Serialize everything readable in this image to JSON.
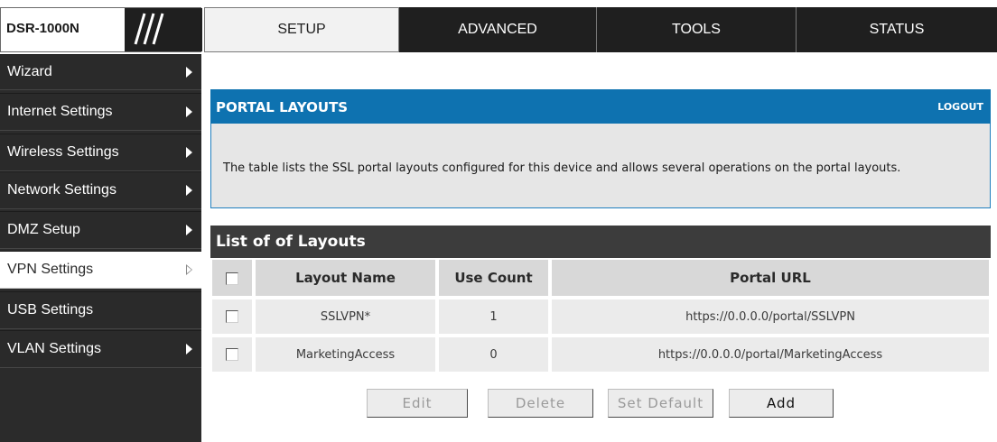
{
  "brand": {
    "model": "DSR-1000N"
  },
  "tabs": [
    {
      "label": "SETUP",
      "active": true
    },
    {
      "label": "ADVANCED",
      "active": false
    },
    {
      "label": "TOOLS",
      "active": false
    },
    {
      "label": "STATUS",
      "active": false
    }
  ],
  "sidebar": {
    "items": [
      {
        "label": "Wizard"
      },
      {
        "label": "Internet Settings"
      },
      {
        "label": "Wireless Settings"
      },
      {
        "label": "Network Settings"
      },
      {
        "label": "DMZ Setup"
      },
      {
        "label": "VPN Settings",
        "active": true
      },
      {
        "label": "USB Settings"
      },
      {
        "label": "VLAN Settings"
      }
    ]
  },
  "panel": {
    "title": "PORTAL LAYOUTS",
    "logout_label": "LOGOUT",
    "description": "The table lists the SSL portal layouts configured for this device and allows several operations on the portal layouts."
  },
  "list": {
    "title": "List of of Layouts",
    "columns": [
      "Layout Name",
      "Use Count",
      "Portal URL"
    ],
    "rows": [
      {
        "name": "SSLVPN*",
        "use_count": "1",
        "url": "https://0.0.0.0/portal/SSLVPN"
      },
      {
        "name": "MarketingAccess",
        "use_count": "0",
        "url": "https://0.0.0.0/portal/MarketingAccess"
      }
    ]
  },
  "buttons": {
    "edit": "Edit",
    "delete": "Delete",
    "set_default": "Set Default",
    "add": "Add"
  },
  "colors": {
    "header_blue": "#0e72b0",
    "dark_bar": "#3c3c3c",
    "sidebar_bg": "#2a2a2a"
  }
}
